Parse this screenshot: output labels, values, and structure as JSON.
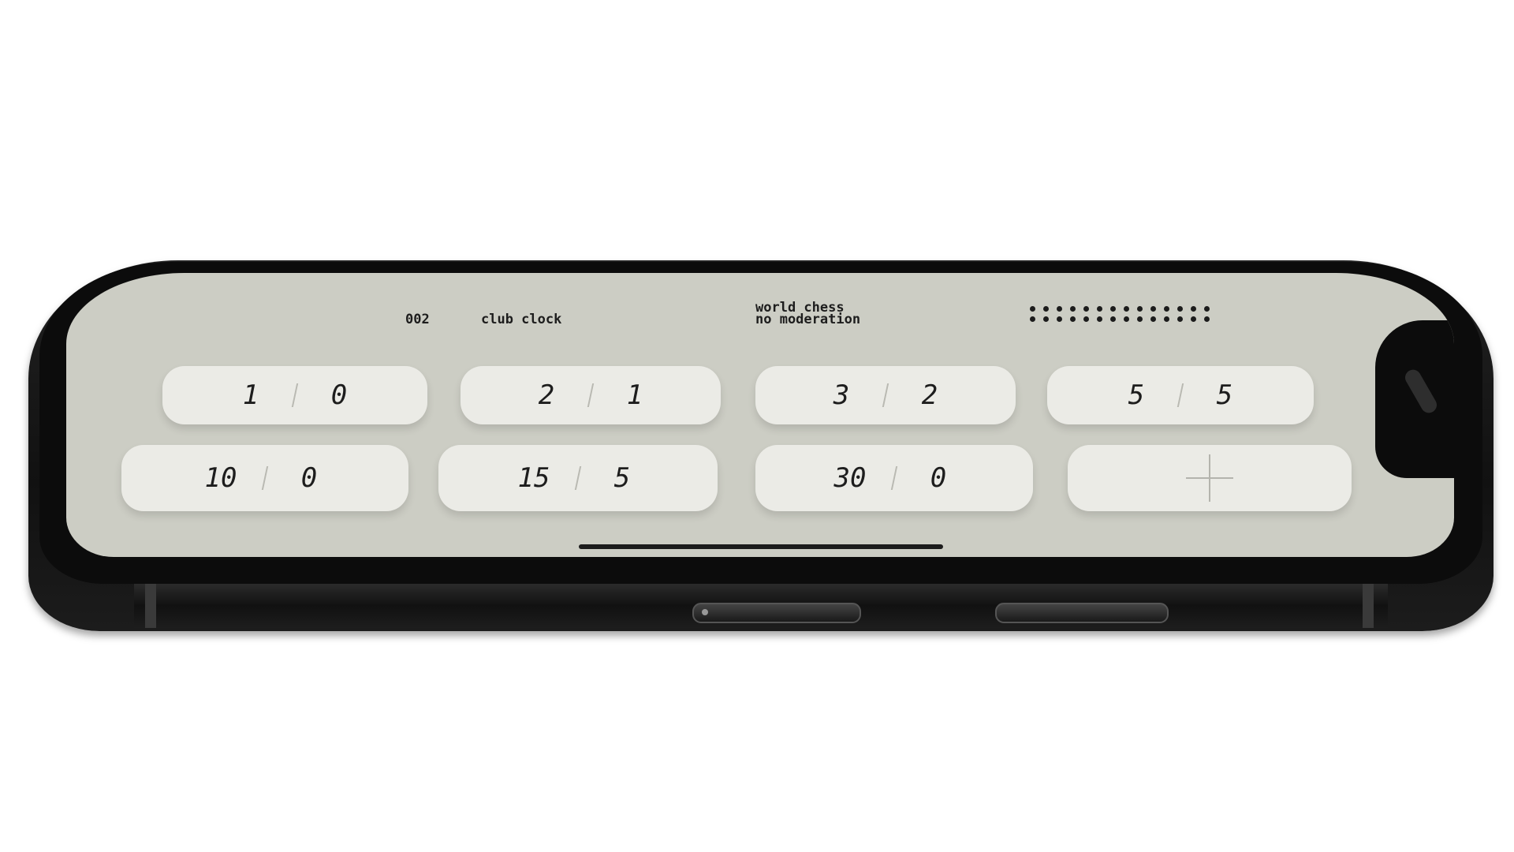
{
  "header": {
    "preset_number": "002",
    "preset_name": "club clock",
    "mode_line1": "world chess",
    "mode_line2": "no moderation"
  },
  "presets_row1": [
    {
      "minutes": "1",
      "increment": "0"
    },
    {
      "minutes": "2",
      "increment": "1"
    },
    {
      "minutes": "3",
      "increment": "2"
    },
    {
      "minutes": "5",
      "increment": "5"
    }
  ],
  "presets_row2": [
    {
      "minutes": "10",
      "increment": "0"
    },
    {
      "minutes": "15",
      "increment": "5"
    },
    {
      "minutes": "30",
      "increment": "0"
    }
  ],
  "add_preset_icon": "plus-icon",
  "colors": {
    "screen_bg": "#cccdc4",
    "card_bg": "#ebebe6",
    "text": "#1d1d1d"
  }
}
